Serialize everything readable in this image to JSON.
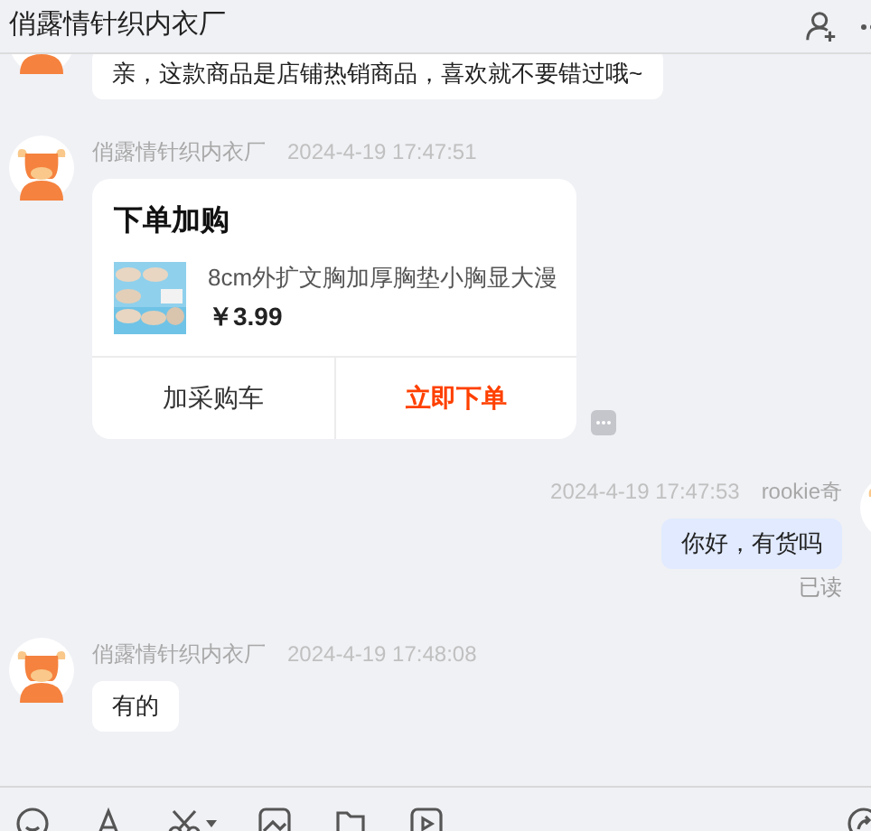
{
  "header": {
    "title": "俏露情针织内衣厂"
  },
  "messages": [
    {
      "kind": "text",
      "outgoing": false,
      "text": "亲，这款商品是店铺热销商品，喜欢就不要错过哦~"
    },
    {
      "kind": "order_card",
      "outgoing": false,
      "sender": "俏露情针织内衣厂",
      "time": "2024-4-19 17:47:51",
      "title": "下单加购",
      "product": {
        "name": "8cm外扩文胸加厚胸垫小胸显大漫",
        "price": "￥3.99"
      },
      "buttons": [
        {
          "label": "加采购车",
          "kind": "secondary"
        },
        {
          "label": "立即下单",
          "kind": "primary"
        }
      ]
    },
    {
      "kind": "text",
      "outgoing": true,
      "sender": "rookie奇",
      "time": "2024-4-19 17:47:53",
      "text": "你好，有货吗",
      "status": "已读"
    },
    {
      "kind": "text",
      "outgoing": false,
      "sender": "俏露情针织内衣厂",
      "time": "2024-4-19 17:48:08",
      "text": "有的"
    }
  ]
}
